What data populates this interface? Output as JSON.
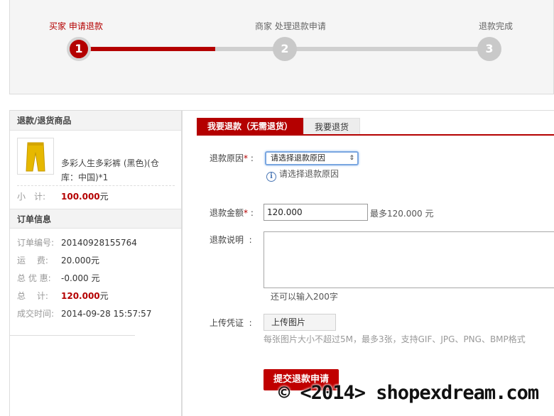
{
  "steps": [
    {
      "label": "买家 申请退款",
      "number": "1",
      "active": true
    },
    {
      "label": "商家 处理退款申请",
      "number": "2",
      "active": false
    },
    {
      "label": "退款完成",
      "number": "3",
      "active": false
    }
  ],
  "progress_fraction": 0.33,
  "left": {
    "goods_header": "退款/退货商品",
    "goods_image_icon": "yellow-pants-image",
    "goods_name": "多彩人生多彩裤 (黑色)(仓库：中国)*1",
    "subtotal_label": "小　计:",
    "subtotal_value": "100.000",
    "subtotal_unit": "元",
    "order_header": "订单信息",
    "order_rows": [
      {
        "label": "订单编号:",
        "value": "20140928155764",
        "strong": false
      },
      {
        "label": "运　 费:",
        "value": "20.000元",
        "strong": false
      },
      {
        "label": "总 优 惠:",
        "value": "-0.000 元",
        "strong": false
      },
      {
        "label": "总　 计:",
        "value": "120.000",
        "unit": "元",
        "strong": true
      },
      {
        "label": "成交时间:",
        "value": "2014-09-28 15:57:57",
        "strong": false
      }
    ]
  },
  "tabs": {
    "active": "我要退款（无需退货）",
    "inactive": "我要退货"
  },
  "form": {
    "reason_label": "退款原因",
    "required_mark": "*",
    "reason_select_value": "请选择退款原因",
    "reason_hint": "请选择退款原因",
    "amount_label": "退款金额",
    "amount_value": "120.000",
    "amount_max": "最多120.000 元",
    "desc_label": "退款说明",
    "desc_remaining": "还可以输入200字",
    "upload_label": "上传凭证",
    "upload_button": "上传图片",
    "upload_note": "每张图片大小不超过5M，最多3张，支持GIF、JPG、PNG、BMP格式",
    "submit_button": "提交退款申请"
  },
  "watermark": "© <2014> shopexdream.com",
  "colors": {
    "accent": "#b40000",
    "inactive_step": "#c9c9c9",
    "panel_bg": "#f5f5f5"
  }
}
